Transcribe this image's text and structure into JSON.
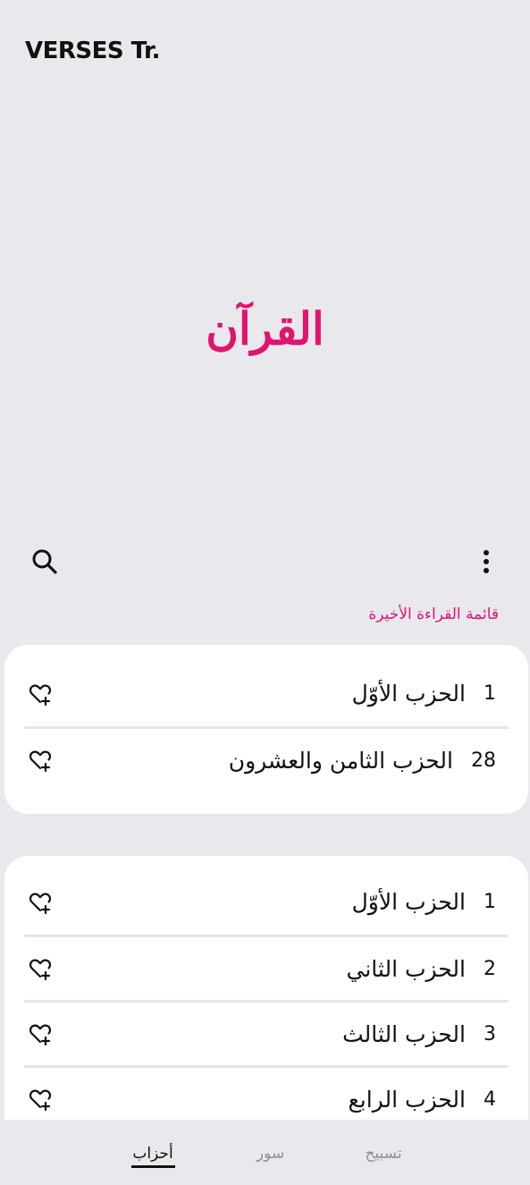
{
  "app": {
    "title": "VERSES Tr."
  },
  "hero": {
    "title": "القرآن"
  },
  "toolbar": {
    "search_icon": "search-icon",
    "more_icon": "more-vertical-icon"
  },
  "recent": {
    "label": "قائمة القراءة الأخيرة",
    "items": [
      {
        "num": "1",
        "name": "الحزب الأوّل"
      },
      {
        "num": "28",
        "name": "الحزب الثامن والعشرون"
      }
    ]
  },
  "list": {
    "items": [
      {
        "num": "1",
        "name": "الحزب الأوّل"
      },
      {
        "num": "2",
        "name": "الحزب الثاني"
      },
      {
        "num": "3",
        "name": "الحزب الثالث"
      },
      {
        "num": "4",
        "name": "الحزب الرابع"
      }
    ]
  },
  "tabs": {
    "ahzab": "أحزاب",
    "suwar": "سور",
    "tasbih": "تسبيح"
  },
  "colors": {
    "accent": "#e2136e",
    "background": "#e9e9ed",
    "card": "#ffffff"
  }
}
